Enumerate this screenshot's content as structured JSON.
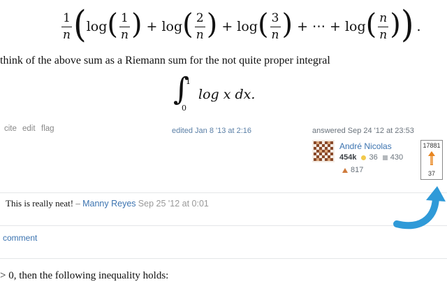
{
  "formula_top": {
    "coef_num": "1",
    "coef_den": "n",
    "log": "log",
    "terms": [
      {
        "num": "1",
        "den": "n"
      },
      {
        "num": "2",
        "den": "n"
      },
      {
        "num": "3",
        "den": "n"
      },
      {
        "num": "n",
        "den": "n"
      }
    ],
    "plus": "+",
    "dots": "⋯",
    "period": "."
  },
  "paragraph1": "think of the above sum as a Riemann sum for the not quite proper integral",
  "integral": {
    "sign": "∫",
    "upper": "1",
    "lower": "0",
    "body": "log x dx."
  },
  "post_menu": {
    "cite": "cite",
    "edit": "edit",
    "flag": "flag",
    "edited": "edited Jan 8 '13 at 2:16"
  },
  "user_card": {
    "answered": "answered Sep 24 '12 at 23:53",
    "name": "André Nicolas",
    "reputation": "454k",
    "gold": "36",
    "silver": "430",
    "bronze": "817"
  },
  "vote": {
    "top": "17881",
    "bottom": "37",
    "arrow_icon": "upvote-arrow-icon"
  },
  "comment": {
    "text": "This is really neat!",
    "dash": "–",
    "author": "Manny Reyes",
    "date": "Sep 25 '12 at 0:01"
  },
  "add_comment": "comment",
  "bottom_text": "> 0, then the following inequality holds:",
  "colors": {
    "link": "#3b73b0",
    "gold": "#f2c94c",
    "silver": "#b4b8bc",
    "bronze": "#cf7b3c",
    "arrow": "#2f9ad8"
  }
}
